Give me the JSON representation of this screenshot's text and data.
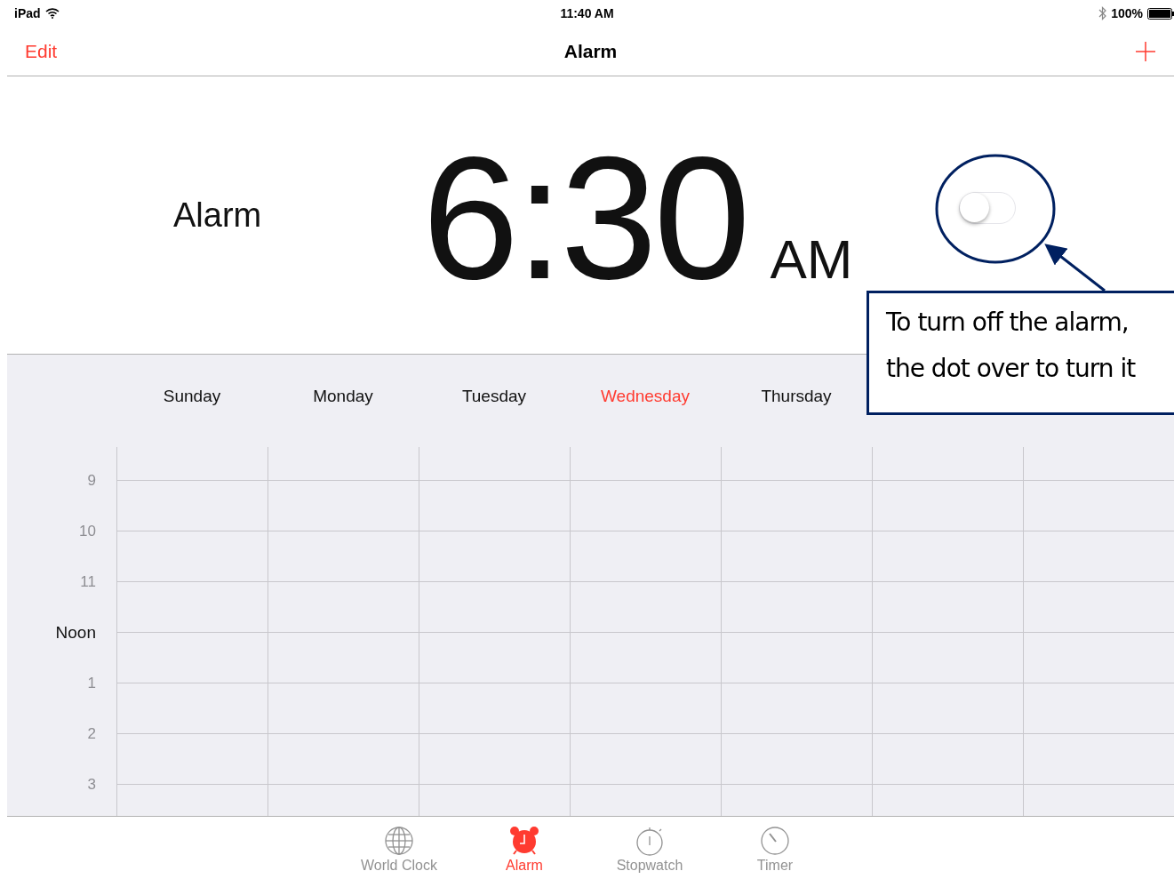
{
  "status_bar": {
    "device": "iPad",
    "time": "11:40 AM",
    "battery": "100%"
  },
  "nav": {
    "left": "Edit",
    "title": "Alarm"
  },
  "alarm": {
    "label": "Alarm",
    "time": "6:30",
    "period": "AM",
    "on": false
  },
  "calendar": {
    "days": [
      {
        "label": "Sunday",
        "selected": false
      },
      {
        "label": "Monday",
        "selected": false
      },
      {
        "label": "Tuesday",
        "selected": false
      },
      {
        "label": "Wednesday",
        "selected": true
      },
      {
        "label": "Thursday",
        "selected": false
      }
    ],
    "hours": [
      {
        "label": "9",
        "emphasis": false
      },
      {
        "label": "10",
        "emphasis": false
      },
      {
        "label": "11",
        "emphasis": false
      },
      {
        "label": "Noon",
        "emphasis": true
      },
      {
        "label": "1",
        "emphasis": false
      },
      {
        "label": "2",
        "emphasis": false
      },
      {
        "label": "3",
        "emphasis": false
      }
    ]
  },
  "callout": {
    "lines": [
      "To turn off the alarm,",
      "the dot over to turn it"
    ]
  },
  "tab_bar": [
    {
      "kind": "globe",
      "label": "World Clock",
      "selected": false
    },
    {
      "kind": "alarm",
      "label": "Alarm",
      "selected": true
    },
    {
      "kind": "stopwatch",
      "label": "Stopwatch",
      "selected": false
    },
    {
      "kind": "timer",
      "label": "Timer",
      "selected": false
    }
  ]
}
